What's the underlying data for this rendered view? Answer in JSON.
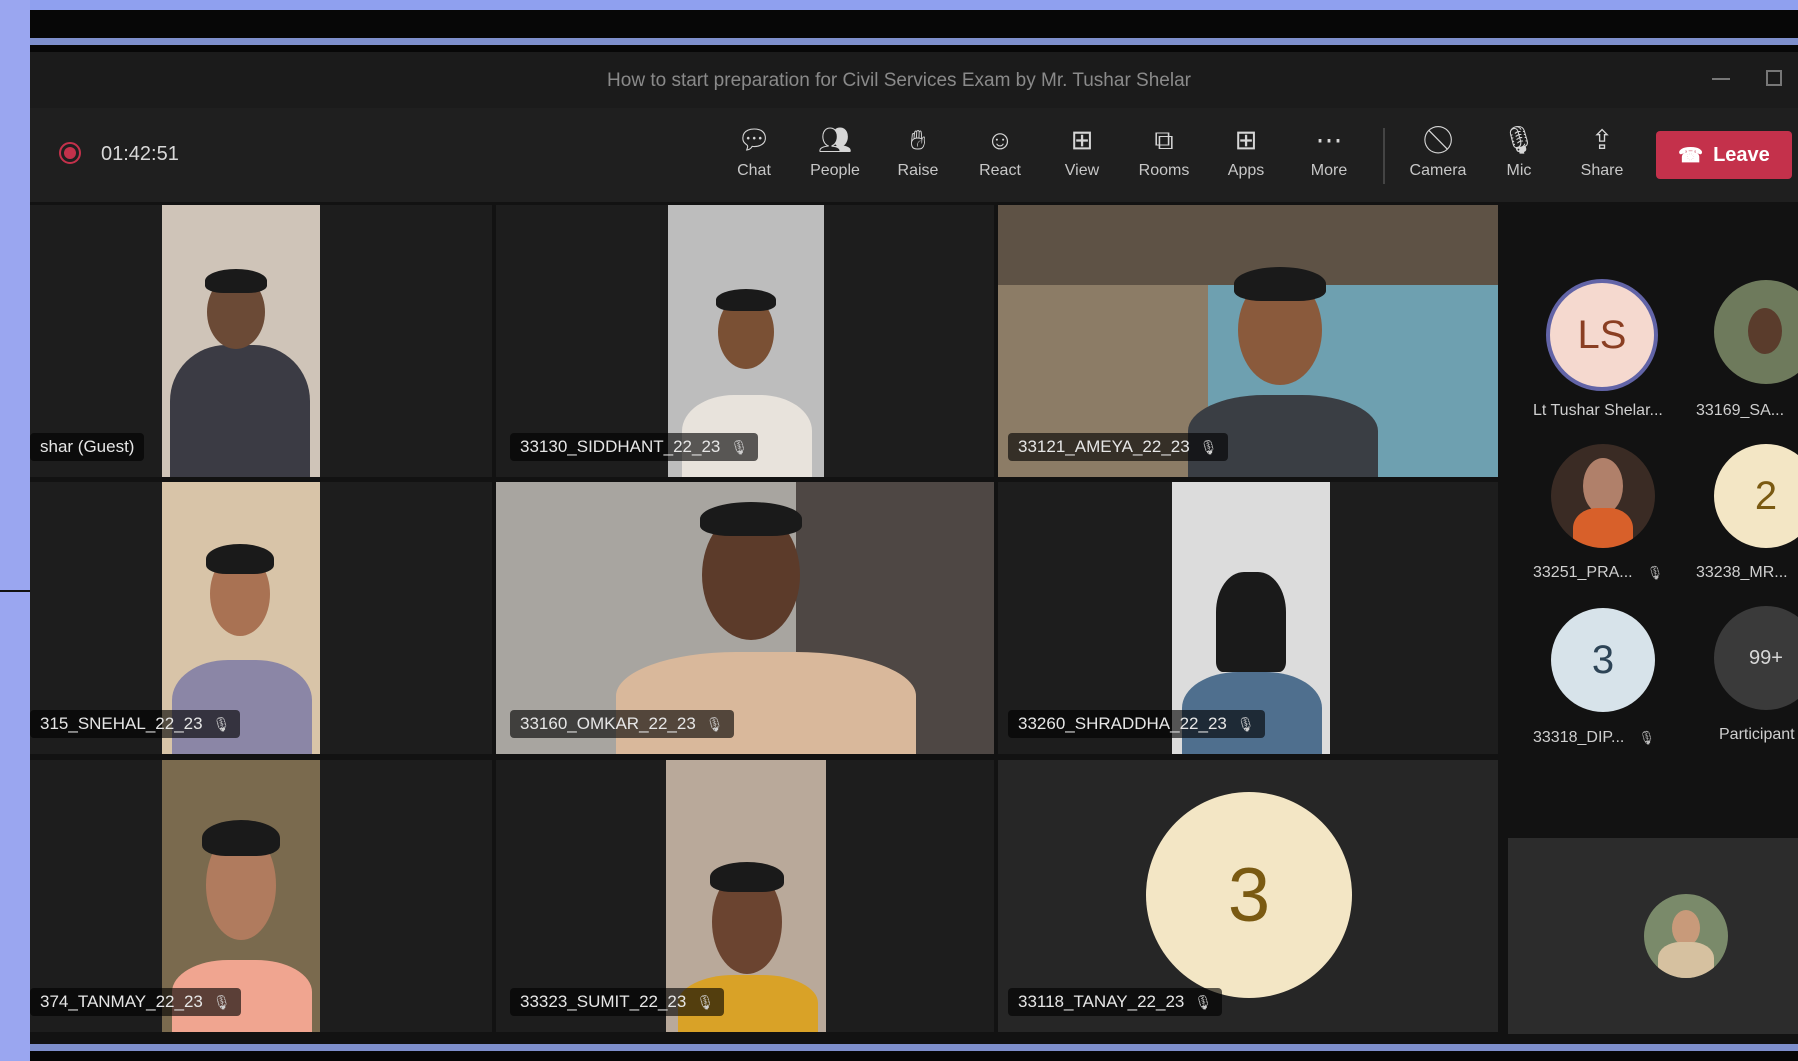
{
  "window": {
    "title": "How to start preparation for Civil Services Exam by Mr. Tushar Shelar"
  },
  "recording": {
    "elapsed": "01:42:51"
  },
  "toolbar": {
    "items": [
      {
        "label": "Chat",
        "icon": "chat-icon"
      },
      {
        "label": "People",
        "icon": "people-icon"
      },
      {
        "label": "Raise",
        "icon": "raise-hand-icon"
      },
      {
        "label": "React",
        "icon": "react-icon"
      },
      {
        "label": "View",
        "icon": "view-grid-icon"
      },
      {
        "label": "Rooms",
        "icon": "rooms-icon"
      },
      {
        "label": "Apps",
        "icon": "apps-icon"
      },
      {
        "label": "More",
        "icon": "more-icon"
      },
      {
        "label": "Camera",
        "icon": "camera-off-icon"
      },
      {
        "label": "Mic",
        "icon": "mic-off-icon"
      },
      {
        "label": "Share",
        "icon": "share-icon"
      }
    ],
    "leave_label": "Leave"
  },
  "grid": {
    "tiles": [
      {
        "name": "shar (Guest)",
        "muted": false
      },
      {
        "name": "33130_SIDDHANT_22_23",
        "muted": true
      },
      {
        "name": "33121_AMEYA_22_23",
        "muted": true
      },
      {
        "name": "315_SNEHAL_22_23",
        "muted": true
      },
      {
        "name": "33160_OMKAR_22_23",
        "muted": true
      },
      {
        "name": "33260_SHRADDHA_22_23",
        "muted": true
      },
      {
        "name": "374_TANMAY_22_23",
        "muted": true
      },
      {
        "name": "33323_SUMIT_22_23",
        "muted": true
      },
      {
        "name": "33118_TANAY_22_23",
        "muted": true,
        "avatar": "3"
      }
    ]
  },
  "sidebar": {
    "participants": [
      {
        "initials": "LS",
        "name": "Lt Tushar Shelar...",
        "color": "#f5d9cf"
      },
      {
        "name": "33169_SA..."
      },
      {
        "name": "33251_PRA...",
        "muted": true
      },
      {
        "initials": "2",
        "name": "33238_MR...",
        "color": "#f3e6c5"
      },
      {
        "initials": "3",
        "name": "33318_DIP...",
        "muted": true,
        "color": "#d7e3ea"
      },
      {
        "initials": "99+",
        "name": "Participant",
        "color": "#3a3a3a"
      }
    ]
  },
  "colors": {
    "leave": "#c4314b",
    "accent": "#6264a7",
    "recording": "#c4314b"
  }
}
